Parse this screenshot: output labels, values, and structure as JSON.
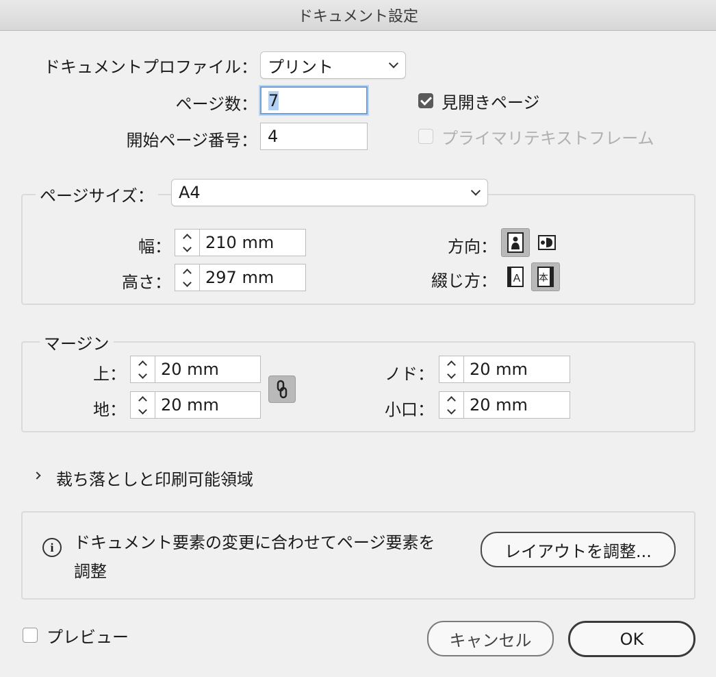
{
  "window": {
    "title": "ドキュメント設定"
  },
  "document_profile": {
    "label": "ドキュメントプロファイル：",
    "value": "プリント"
  },
  "pages": {
    "label": "ページ数：",
    "value": "7"
  },
  "start_page": {
    "label": "開始ページ番号：",
    "value": "4"
  },
  "facing_pages": {
    "label": "見開きページ",
    "checked": true
  },
  "primary_text_frame": {
    "label": "プライマリテキストフレーム",
    "checked": false,
    "enabled": false
  },
  "page_size": {
    "label": "ページサイズ：",
    "value": "A4",
    "width_label": "幅：",
    "width_value": "210 mm",
    "height_label": "高さ：",
    "height_value": "297 mm",
    "orientation_label": "方向：",
    "binding_label": "綴じ方："
  },
  "margins": {
    "title": "マージン",
    "top_label": "上：",
    "top_value": "20 mm",
    "bottom_label": "地：",
    "bottom_value": "20 mm",
    "inside_label": "ノド：",
    "inside_value": "20 mm",
    "outside_label": "小口：",
    "outside_value": "20 mm"
  },
  "bleed": {
    "label": "裁ち落としと印刷可能領域"
  },
  "info": {
    "line1": "ドキュメント要素の変更に合わせてページ要素を",
    "line2": "調整",
    "adjust_button": "レイアウトを調整..."
  },
  "preview": {
    "label": "プレビュー",
    "checked": false
  },
  "buttons": {
    "cancel": "キャンセル",
    "ok": "OK"
  }
}
